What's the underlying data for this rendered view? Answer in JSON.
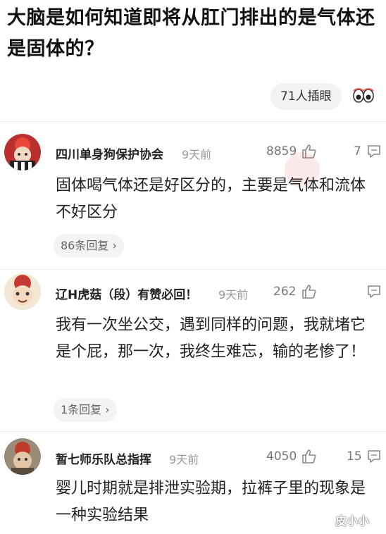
{
  "question": {
    "title": "大脑是如何知道即将从肛门排出的是气体还是固体的？",
    "views_label": "71人插眼"
  },
  "comments": [
    {
      "username": "四川单身狗保护协会",
      "time": "9天前",
      "likes": "8859",
      "replies_count": "7",
      "text": "固体喝气体还是好区分的，主要是气体和流体不好区分",
      "replies_label": "86条回复 ›"
    },
    {
      "username": "辽H虎菇（段）有赞必回！",
      "time": "9天前",
      "likes": "262",
      "replies_count": "",
      "text": "我有一次坐公交，遇到同样的问题，我就堵它是个屁，那一次，我终生难忘，输的老惨了！",
      "replies_label": "1条回复 ›"
    },
    {
      "username": "暂七师乐队总指挥",
      "time": "9天前",
      "likes": "4050",
      "replies_count": "15",
      "text": "婴儿时期就是排泄实验期，拉裤子里的现象是一种实验结果"
    }
  ],
  "watermark": "皮小小",
  "icons": {
    "like": "thumbs-up-icon",
    "comment": "comment-bubble-icon",
    "eyes": "eyes-icon"
  }
}
